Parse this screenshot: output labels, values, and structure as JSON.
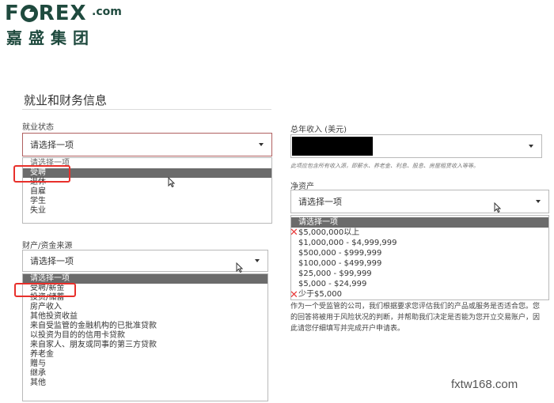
{
  "logo": {
    "brand": "FOREX",
    "domain": ".com",
    "chinese": "嘉盛集团"
  },
  "section_title": "就业和财务信息",
  "employment": {
    "label": "就业状态",
    "placeholder": "请选择一项",
    "options": [
      "请选择一项",
      "受聘",
      "退休",
      "自雇",
      "学生",
      "失业"
    ],
    "selected_index": 1
  },
  "funds": {
    "label": "财产/资金来源",
    "placeholder": "请选择一项",
    "options": [
      "请选择一项",
      "受聘/薪金",
      "投资/储蓄",
      "房产收入",
      "其他投资收益",
      "来自受监管的金融机构的已批准贷款",
      "以投资为目的的信用卡贷款",
      "来自家人、朋友或同事的第三方贷款",
      "养老金",
      "赠与",
      "继承",
      "其他"
    ],
    "selected_index": 0
  },
  "income": {
    "label": "总年收入 (美元)",
    "hint": "此项应包含所有收入源，即薪水、养老金、利息、股息、房屋租赁收入等等。"
  },
  "networth": {
    "label": "净资产",
    "placeholder": "请选择一项",
    "options": [
      "请选择一项",
      "$5,000,000以上",
      "$1,000,000 - $4,999,999",
      "$500,000 - $999,999",
      "$100,000 - $499,999",
      "$25,000 - $99,999",
      "$5,000 - $24,999",
      "少于$5,000"
    ],
    "selected_index": 0,
    "marked": [
      "$5,000,000以上",
      "少于$5,000"
    ]
  },
  "disclaimer": {
    "line1": "作为一个受监管的公司，我们根据要求您评估我们的产品或服务是否适合您。您",
    "line2": "的回答将被用于风险状况的判断，并帮助我们决定是否能为您开立交易账户，因",
    "line3": "此请您仔细填写并完成开户申请表。"
  },
  "watermark": "fxtw168.com",
  "colors": {
    "brand_green": "#1f4a3e",
    "highlight_red": "#e8302b",
    "selected_bg": "#6b6b6b"
  }
}
